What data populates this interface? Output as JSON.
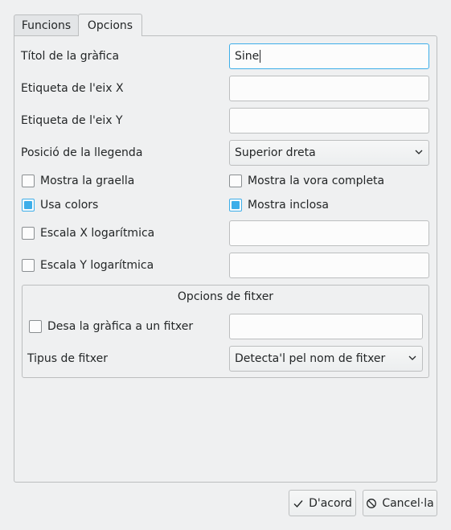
{
  "tabs": [
    {
      "label": "Funcions",
      "active": false
    },
    {
      "label": "Opcions",
      "active": true
    }
  ],
  "form": {
    "title_label": "Títol de la gràfica",
    "title_value": "Sine",
    "xlabel_label": "Etiqueta de l'eix X",
    "xlabel_value": "",
    "ylabel_label": "Etiqueta de l'eix Y",
    "ylabel_value": "",
    "legend_label": "Posició de la llegenda",
    "legend_value": "Superior dreta"
  },
  "checkboxes": {
    "show_grid": {
      "label": "Mostra la graella",
      "checked": false
    },
    "show_full_border": {
      "label": "Mostra la vora completa",
      "checked": false
    },
    "use_colors": {
      "label": "Usa colors",
      "checked": true
    },
    "show_inclusive": {
      "label": "Mostra inclosa",
      "checked": true
    },
    "log_x": {
      "label": "Escala X logarítmica",
      "checked": false
    },
    "log_y": {
      "label": "Escala Y logarítmica",
      "checked": false
    }
  },
  "file_group": {
    "title": "Opcions de fitxer",
    "save_label": "Desa la gràfica a un fitxer",
    "save_checked": false,
    "save_path": "",
    "filetype_label": "Tipus de fitxer",
    "filetype_value": "Detecta'l pel nom de fitxer"
  },
  "buttons": {
    "ok": "D'acord",
    "cancel": "Cancel·la"
  },
  "colors": {
    "accent": "#3daee9",
    "window_bg": "#eff0f1",
    "border": "#bcbebf"
  }
}
